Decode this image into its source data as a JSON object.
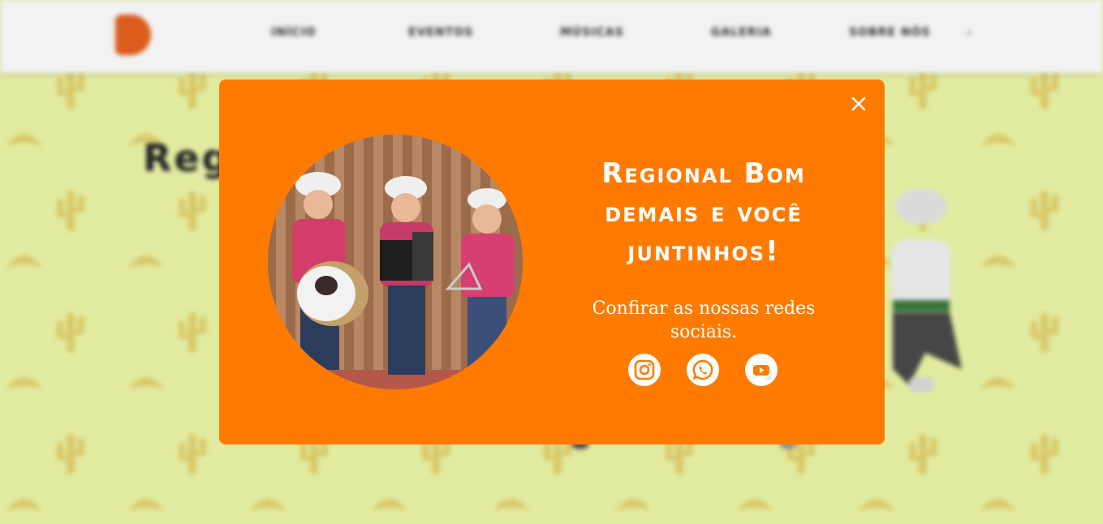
{
  "background": {
    "nav": {
      "items": [
        "INÍCIO",
        "EVENTOS",
        "MÚSICAS",
        "GALERIA",
        "SOBRE NÓS"
      ],
      "caret": "⌄"
    },
    "hero_title": "Regi"
  },
  "modal": {
    "close_icon": "close-icon",
    "title": "Regional Bom demais e você juntinhos!",
    "subtitle": "Confirar as nossas redes sociais.",
    "socials": [
      {
        "icon": "instagram-icon"
      },
      {
        "icon": "whatsapp-icon"
      },
      {
        "icon": "youtube-icon"
      }
    ]
  },
  "colors": {
    "modal_bg": "#ff7b00",
    "page_bg": "#eef8a8",
    "logo": "#e8611f",
    "youtube": "#e8611f"
  }
}
